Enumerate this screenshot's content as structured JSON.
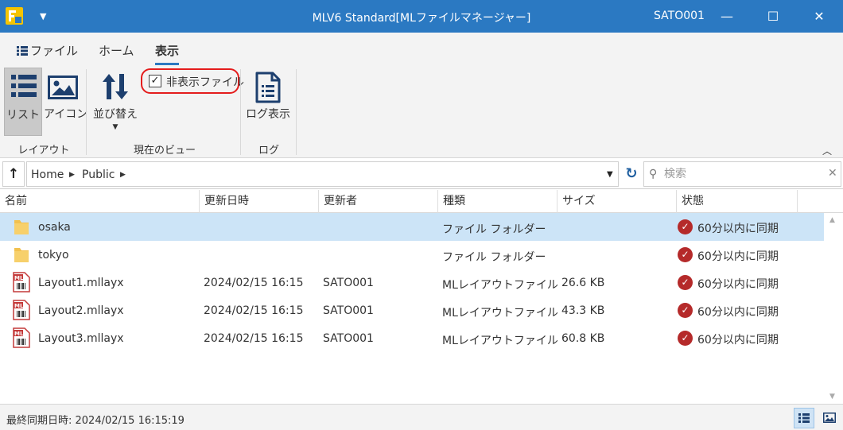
{
  "titlebar": {
    "title": "MLV6 Standard[MLファイルマネージャー]",
    "user": "SATO001",
    "minimize": "—",
    "maximize": "☐",
    "close": "✕",
    "qa_caret": "▼"
  },
  "ribbon": {
    "tabs": [
      {
        "label": "ファイル"
      },
      {
        "label": "ホーム"
      },
      {
        "label": "表示",
        "active": true
      }
    ],
    "buttons": {
      "list": "リスト",
      "icon": "アイコン",
      "sort": "並び替え",
      "log": "ログ表示"
    },
    "hidden_files_label": "非表示ファイル",
    "hidden_files_checked": true,
    "groups": {
      "layout": "レイアウト",
      "current_view": "現在のビュー",
      "log": "ログ"
    }
  },
  "address": {
    "crumbs": [
      "Home",
      "Public"
    ],
    "search_placeholder": "検索"
  },
  "columns": [
    "名前",
    "更新日時",
    "更新者",
    "種類",
    "サイズ",
    "状態"
  ],
  "files": [
    {
      "name": "osaka",
      "modified": "",
      "modifier": "",
      "type": "ファイル フォルダー",
      "size": "",
      "status": "60分以内に同期",
      "icon": "folder-icon",
      "selected": true
    },
    {
      "name": "tokyo",
      "modified": "",
      "modifier": "",
      "type": "ファイル フォルダー",
      "size": "",
      "status": "60分以内に同期",
      "icon": "folder-icon",
      "selected": false
    },
    {
      "name": "Layout1.mllayx",
      "modified": "2024/02/15 16:15",
      "modifier": "SATO001",
      "type": "MLレイアウトファイル",
      "size": "26.6 KB",
      "status": "60分以内に同期",
      "icon": "ml-layout-file-icon",
      "selected": false
    },
    {
      "name": "Layout2.mllayx",
      "modified": "2024/02/15 16:15",
      "modifier": "SATO001",
      "type": "MLレイアウトファイル",
      "size": "43.3 KB",
      "status": "60分以内に同期",
      "icon": "ml-layout-file-icon",
      "selected": false
    },
    {
      "name": "Layout3.mllayx",
      "modified": "2024/02/15 16:15",
      "modifier": "SATO001",
      "type": "MLレイアウトファイル",
      "size": "60.8 KB",
      "status": "60分以内に同期",
      "icon": "ml-layout-file-icon",
      "selected": false
    }
  ],
  "statusbar": {
    "last_sync": "最終同期日時: 2024/02/15 16:15:19"
  },
  "colors": {
    "titlebar": "#2b79c2",
    "selected_row": "#cce4f7",
    "highlight_border": "#e41c1c",
    "status_icon": "#b52a2a",
    "folder": "#f2c14e"
  }
}
